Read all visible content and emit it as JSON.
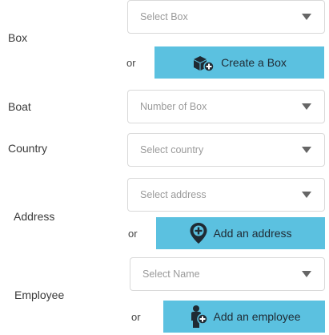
{
  "form": {
    "box": {
      "label": "Box",
      "placeholder": "Select Box",
      "or": "or",
      "button": "Create a Box",
      "button_icon": "box-plus-icon"
    },
    "boat": {
      "label": "Boat",
      "placeholder": "Number of Box"
    },
    "country": {
      "label": "Country",
      "placeholder": "Select country"
    },
    "address": {
      "label": "Address",
      "placeholder": "Select address",
      "or": "or",
      "button": "Add an address",
      "button_icon": "location-plus-icon"
    },
    "employee": {
      "label": "Employee",
      "placeholder": "Select Name",
      "or": "or",
      "button": "Add an employee",
      "button_icon": "person-plus-icon"
    }
  },
  "colors": {
    "button_bg": "#5bc1e0",
    "icon_dark": "#1f2a33",
    "placeholder": "#9a9a9a",
    "border": "#d9d9d9"
  }
}
